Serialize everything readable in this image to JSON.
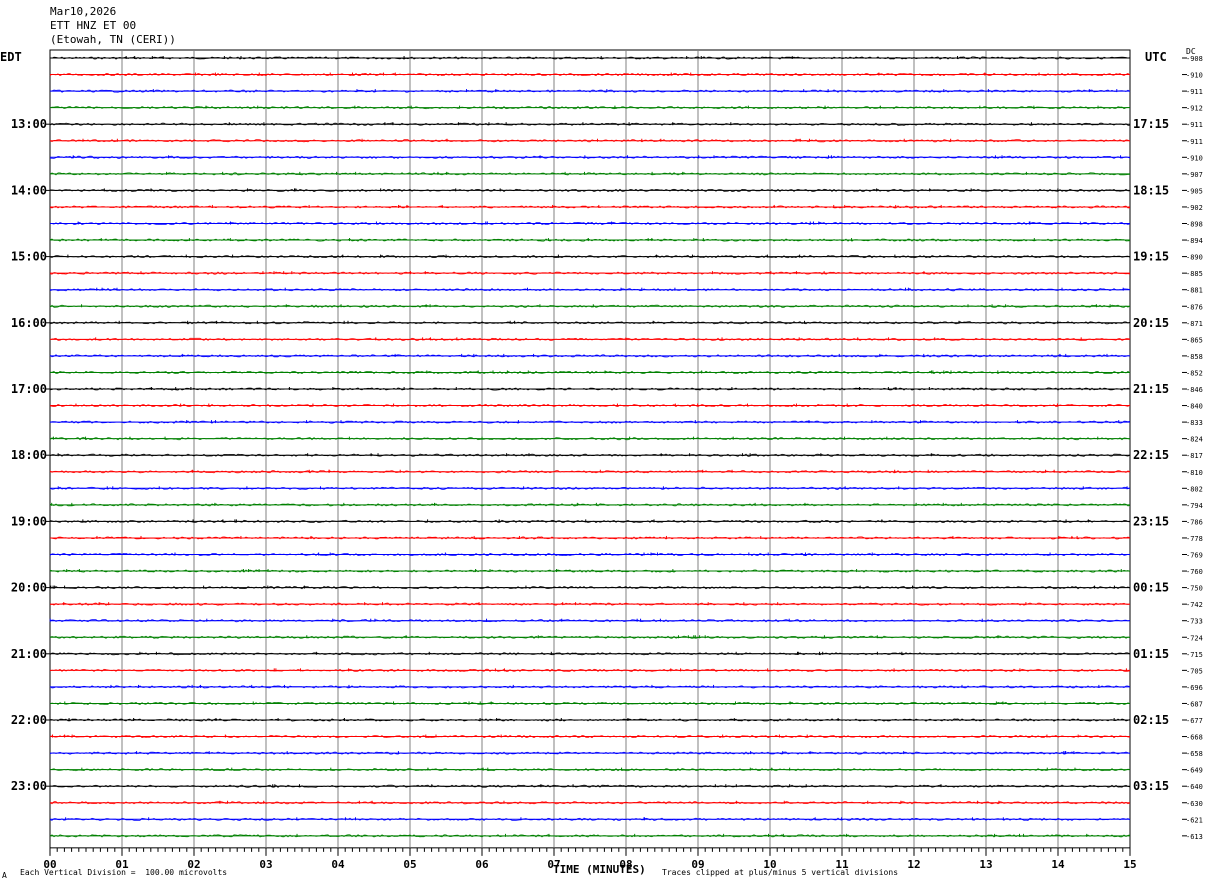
{
  "header": {
    "date": "Mar10,2026",
    "station": "ETT HNZ ET 00",
    "location": "(Etowah, TN (CERI))"
  },
  "left_axis_title": "EDT",
  "right_axis_title": "UTC",
  "dc_label": "DC",
  "footer": {
    "left": "Each Vertical Division =  100.00 microvolts",
    "right": "Traces clipped at plus/minus 5 vertical divisions",
    "xlabel": "TIME (MINUTES)",
    "flag": "A"
  },
  "chart_data": {
    "type": "line",
    "title": "",
    "xlabel": "TIME (MINUTES)",
    "xlim": [
      0,
      15
    ],
    "x_ticks": [
      "00",
      "01",
      "02",
      "03",
      "04",
      "05",
      "06",
      "07",
      "08",
      "09",
      "10",
      "11",
      "12",
      "13",
      "14",
      "15"
    ],
    "trace_minutes": 15,
    "trace_colors": [
      "#000000",
      "#ff0000",
      "#0000ff",
      "#008000"
    ],
    "grid_color": "#808080",
    "edt_labels": [
      "13:00",
      "14:00",
      "15:00",
      "16:00",
      "17:00",
      "18:00",
      "19:00",
      "20:00",
      "21:00",
      "22:00",
      "23:00"
    ],
    "utc_labels": [
      "17:15",
      "18:15",
      "19:15",
      "20:15",
      "21:15",
      "22:15",
      "23:15",
      "00:15",
      "01:15",
      "02:15",
      "03:15"
    ],
    "dc_offsets": [
      -908,
      -910,
      -911,
      -912,
      -911,
      -911,
      -910,
      -907,
      -905,
      -902,
      -898,
      -894,
      -890,
      -885,
      -881,
      -876,
      -871,
      -865,
      -858,
      -852,
      -846,
      -840,
      -833,
      -824,
      -817,
      -810,
      -802,
      -794,
      -786,
      -778,
      -769,
      -760,
      -750,
      -742,
      -733,
      -724,
      -715,
      -705,
      -696,
      -687,
      -677,
      -668,
      -658,
      -649,
      -640,
      -630,
      -621,
      -613
    ]
  }
}
